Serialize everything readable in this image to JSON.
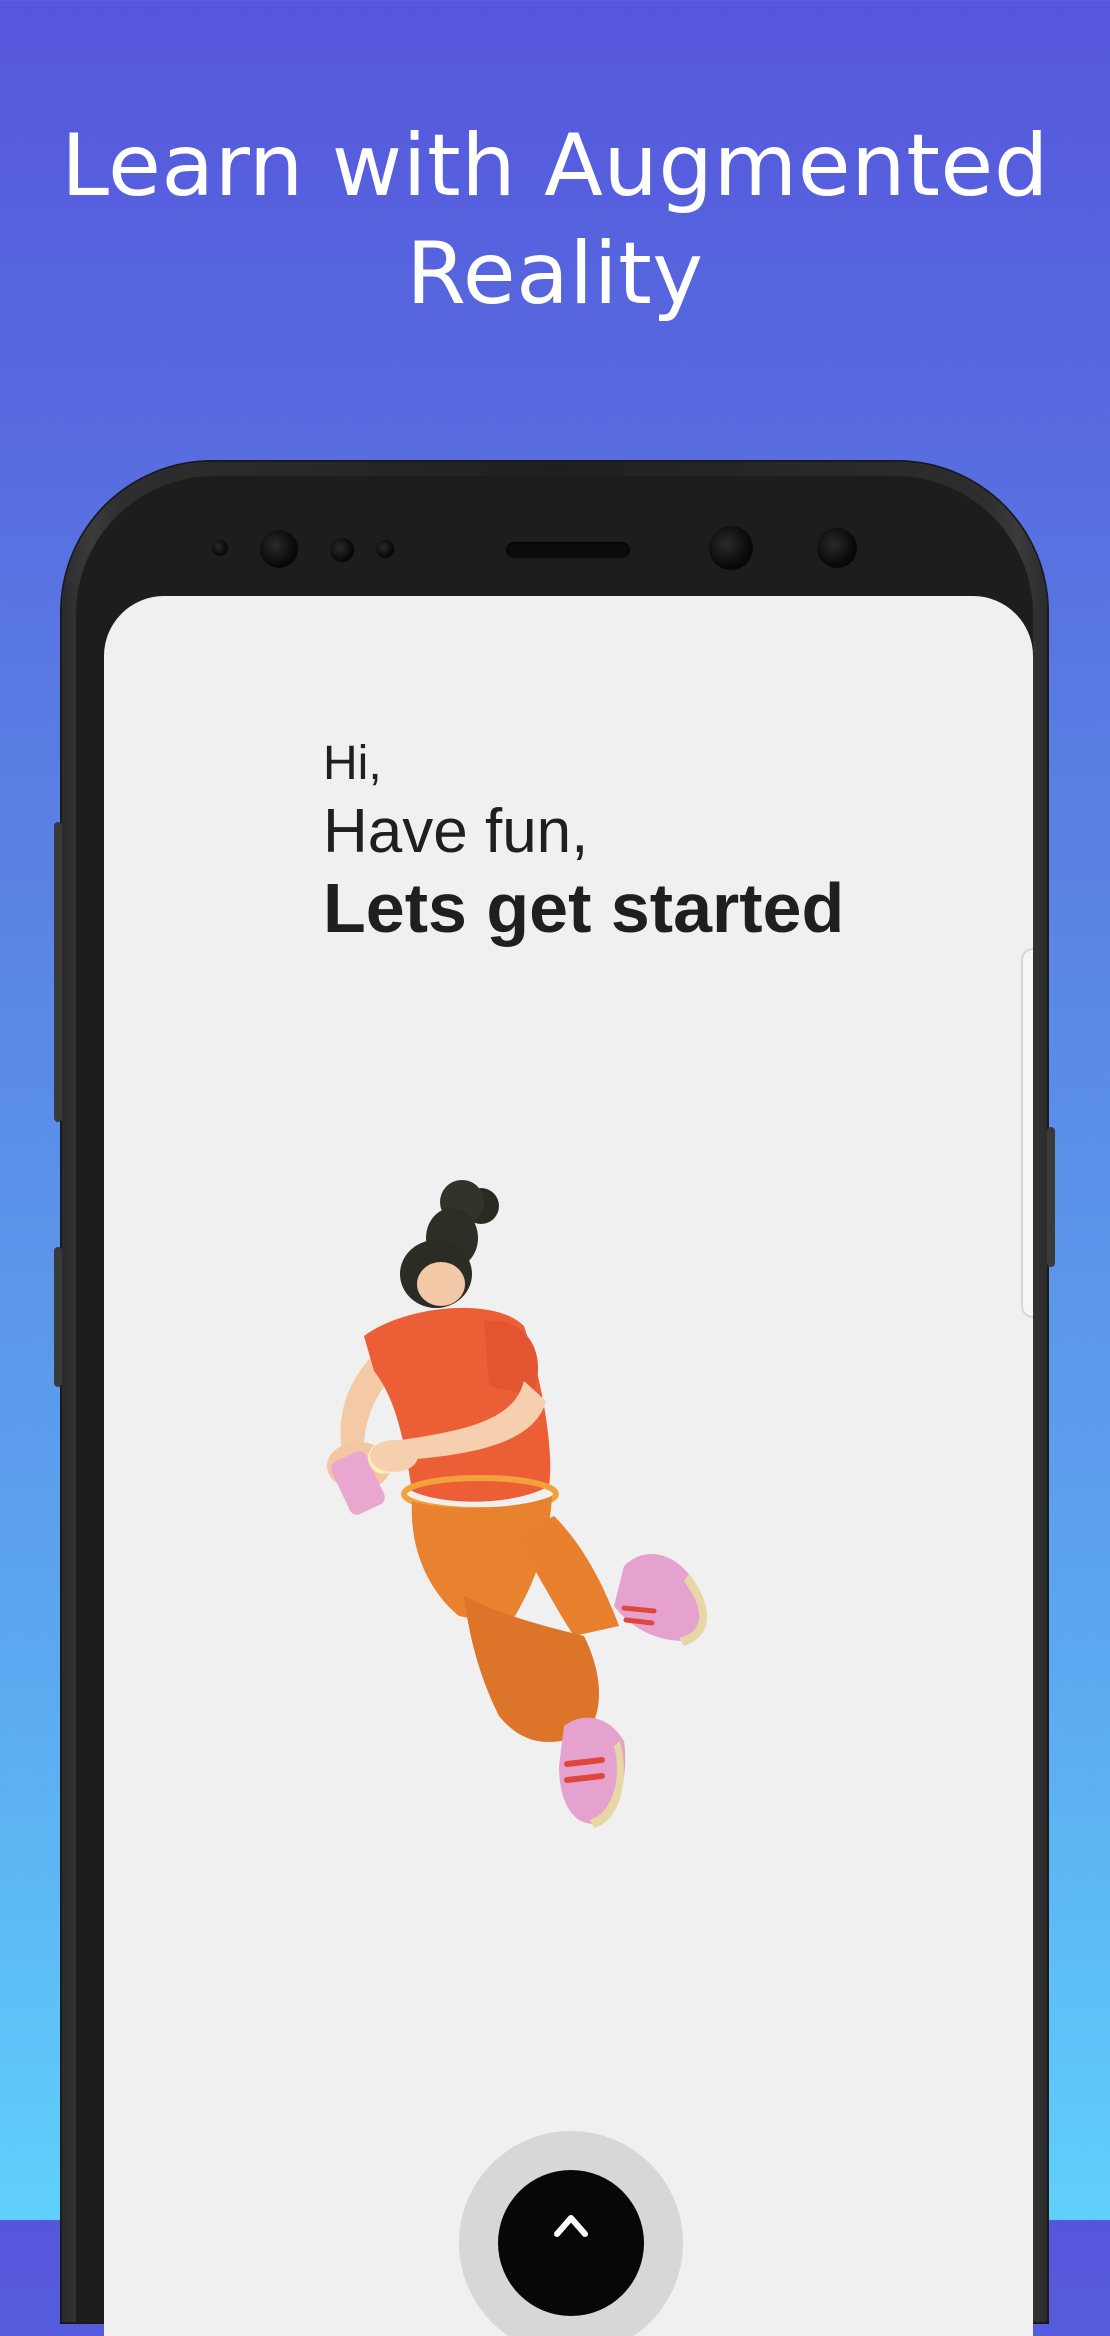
{
  "promo": {
    "title_line1": "Learn with Augmented",
    "title_line2": "Reality"
  },
  "screen": {
    "greeting_hi": "Hi,",
    "greeting_fun": "Have fun,",
    "greeting_start": "Lets get started"
  },
  "colors": {
    "background_top": "#5556dc",
    "background_bottom": "#5fd0fb",
    "screen_bg": "#f0f0f0",
    "phone_frame": "#1f1f1f",
    "text": "#1f1f1f",
    "shirt": "#ec5f36",
    "pants": "#e9822f",
    "shoes": "#e6a2cf"
  },
  "icons": {
    "start": "chevron-up-icon",
    "illustration": "girl-with-phone-illustration"
  }
}
